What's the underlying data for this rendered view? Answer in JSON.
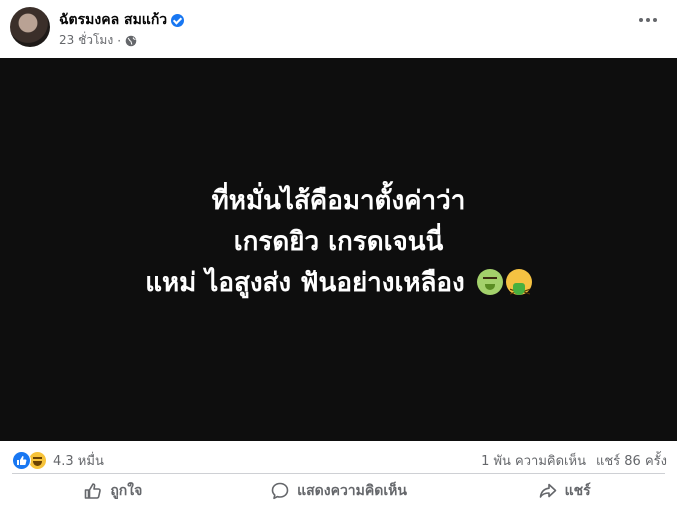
{
  "post": {
    "author": "ฉัตรมงคล สมแก้ว",
    "time": "23 ชั่วโมง",
    "time_separator": "·",
    "image_text": {
      "line1": "ที่หมั่นไส้คือมาตั้งค่าว่า",
      "line2": "เกรดยิว เกรดเจนนี่",
      "line3": "แหม่ ไอสูงส่ง ฟันอย่างเหลือง"
    },
    "emojis": [
      "nauseated-face-emoji",
      "vomiting-face-emoji"
    ]
  },
  "stats": {
    "reactions": "4.3 หมื่น",
    "reaction_icons": [
      "like-icon",
      "haha-icon"
    ],
    "comments": "1 พัน ความคิดเห็น",
    "shares": "แชร์ 86 ครั้ง"
  },
  "actions": {
    "like": "ถูกใจ",
    "comment": "แสดงความคิดเห็น",
    "share": "แชร์"
  },
  "colors": {
    "accent": "#1877f2",
    "image_bg": "#0e0e0e",
    "secondary_text": "#65676b"
  }
}
